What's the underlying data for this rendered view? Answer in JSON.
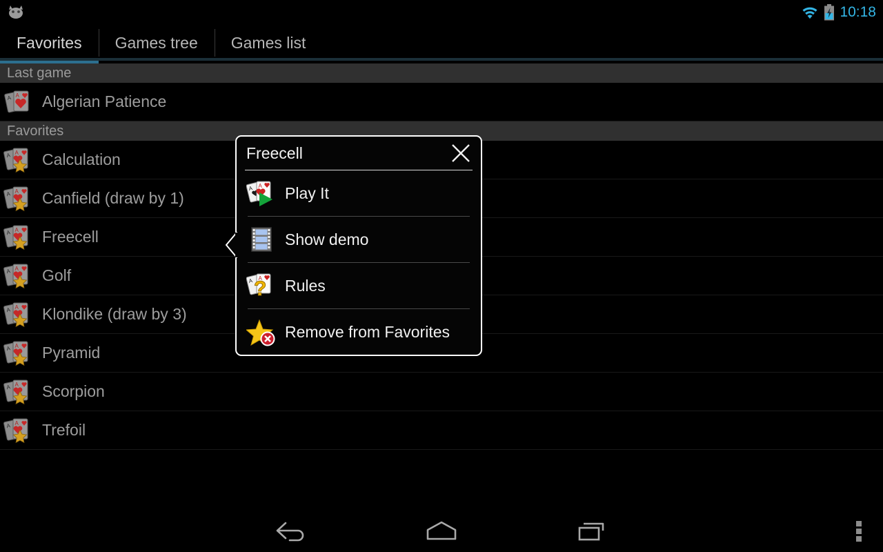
{
  "statusbar": {
    "app_icon": "android-head-icon",
    "wifi_icon": "wifi-icon",
    "battery_icon": "battery-charging-icon",
    "clock": "10:18",
    "accent_color": "#33b5e5"
  },
  "tabs": [
    {
      "label": "Favorites",
      "active": true
    },
    {
      "label": "Games tree",
      "active": false
    },
    {
      "label": "Games list",
      "active": false
    }
  ],
  "tab_indicator_color": "#2c6f8f",
  "sections": [
    {
      "header": "Last game",
      "items": [
        {
          "label": "Algerian Patience",
          "icon": "cards-heart-icon"
        }
      ]
    },
    {
      "header": "Favorites",
      "items": [
        {
          "label": "Calculation",
          "icon": "cards-star-icon"
        },
        {
          "label": "Canfield (draw by 1)",
          "icon": "cards-star-icon"
        },
        {
          "label": "Freecell",
          "icon": "cards-star-icon"
        },
        {
          "label": "Golf",
          "icon": "cards-star-icon"
        },
        {
          "label": "Klondike (draw by 3)",
          "icon": "cards-star-icon"
        },
        {
          "label": "Pyramid",
          "icon": "cards-star-icon"
        },
        {
          "label": "Scorpion",
          "icon": "cards-star-icon"
        },
        {
          "label": "Trefoil",
          "icon": "cards-star-icon"
        }
      ]
    }
  ],
  "popup": {
    "title": "Freecell",
    "close_icon": "close-icon",
    "items": [
      {
        "label": "Play It",
        "icon": "cards-play-icon"
      },
      {
        "label": "Show demo",
        "icon": "film-strip-icon"
      },
      {
        "label": "Rules",
        "icon": "cards-question-icon"
      },
      {
        "label": "Remove from Favorites",
        "icon": "star-remove-icon"
      }
    ]
  },
  "navbar": {
    "back": "back-icon",
    "home": "home-icon",
    "recents": "recents-icon",
    "overflow": "overflow-menu-icon"
  }
}
